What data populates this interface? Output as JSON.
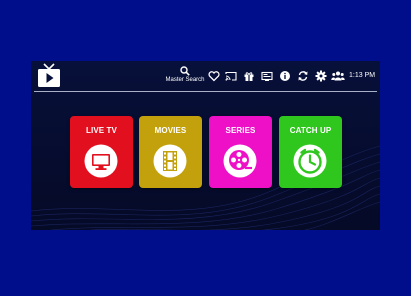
{
  "header": {
    "search_label": "Master Search",
    "icons": [
      "heart-icon",
      "cast-icon",
      "gift-icon",
      "tv-guide-icon",
      "info-icon",
      "refresh-icon",
      "gear-icon",
      "users-icon"
    ],
    "time": "1:13 PM"
  },
  "tiles": [
    {
      "label": "LIVE TV",
      "icon": "monitor-icon",
      "color": "#e2101f"
    },
    {
      "label": "MOVIES",
      "icon": "film-icon",
      "color": "#c3a10c"
    },
    {
      "label": "SERIES",
      "icon": "film-reel-icon",
      "color": "#ee10c6"
    },
    {
      "label": "CATCH UP",
      "icon": "clock-icon",
      "color": "#2fc61e"
    }
  ],
  "colors": {
    "background": "#000e8c",
    "panel": "#07103a",
    "accent": "#ffffff"
  }
}
